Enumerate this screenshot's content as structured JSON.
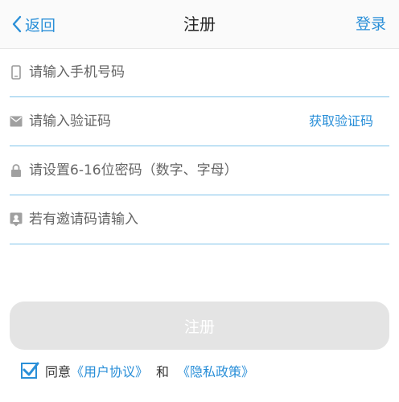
{
  "header": {
    "back_label": "返回",
    "title": "注册",
    "login_label": "登录"
  },
  "form": {
    "phone": {
      "placeholder": "请输入手机号码",
      "icon": "phone-icon"
    },
    "code": {
      "placeholder": "请输入验证码",
      "icon": "mail-icon",
      "action_label": "获取验证码"
    },
    "password": {
      "placeholder": "请设置6-16位密码（数字、字母）",
      "icon": "lock-icon"
    },
    "invite": {
      "placeholder": "若有邀请码请输入",
      "icon": "location-pin-icon"
    },
    "submit_label": "注册"
  },
  "agreement": {
    "checked": true,
    "prefix": "同意",
    "user_agreement": "《用户协议》",
    "and": "和",
    "privacy_policy": "《隐私政策》"
  },
  "colors": {
    "accent": "#2a8fd8",
    "divider": "#7fc3ea",
    "button_disabled": "#e4e4e4"
  }
}
